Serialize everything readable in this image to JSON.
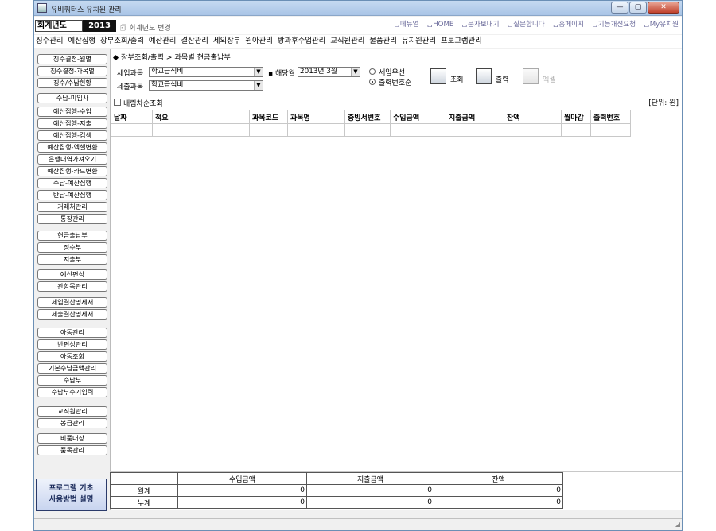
{
  "window": {
    "title": "유비쿼터스 유치원 관리",
    "controls": {
      "min": "—",
      "max": "▢",
      "close": "✕"
    }
  },
  "header": {
    "year_label": "회계년도",
    "year_value": "2013",
    "year_change": "회계년도 변경",
    "links": [
      "메뉴얼",
      "HOME",
      "문자보내기",
      "질문합니다",
      "홈페이지",
      "기능개선요청",
      "My유치원"
    ]
  },
  "menu": {
    "items": [
      "징수관리",
      "예산집행",
      "장부조회/출력",
      "예산관리",
      "결산관리",
      "세외장부",
      "원아관리",
      "방과후수업관리",
      "교직원관리",
      "물품관리",
      "유치원관리",
      "프로그램관리"
    ]
  },
  "sidebar": {
    "items": [
      "징수결정-월별",
      "징수결정-과목별",
      "징수/수납현황",
      "수납-미입사",
      "예산집행-수입",
      "예산집행-지출",
      "예산집행-검색",
      "예산집행-엑셀변환",
      "은행내역가져오기",
      "예산집행-카드변환",
      "수납-예산집행",
      "반납-예산집행",
      "거래처관리",
      "통장관리",
      "현금출납부",
      "징수부",
      "지출부",
      "예산편성",
      "관항목관리",
      "세입결산명세서",
      "세출결산명세서",
      "아동관리",
      "반편성관리",
      "아동조회",
      "기본수납금액관리",
      "수납부",
      "수납부수기입력",
      "교직원관리",
      "봉급관리",
      "비품대장",
      "품목관리"
    ],
    "help_button": [
      "프로그램 기초",
      "사용방법 설명"
    ]
  },
  "main": {
    "breadcrumb": "◆ 장부조회/출력 > 과목별 현금출납부",
    "filters": {
      "income_label": "세입과목",
      "income_value": "학교급식비",
      "expense_label": "세출과목",
      "expense_value": "학교급식비",
      "month_label": "해당월",
      "month_value": "2013년 3월",
      "radio_income_first": "세입우선",
      "radio_output_order": "출력번호순",
      "desc_sort": "내림차순조회"
    },
    "actions": {
      "search": "조회",
      "print": "출력",
      "excel": "엑셀"
    },
    "unit": "[단위: 원]",
    "grid_columns": [
      "날짜",
      "적요",
      "과목코드",
      "과목명",
      "증빙서번호",
      "수입금액",
      "지출금액",
      "잔액",
      "월마감",
      "출력번호"
    ],
    "summary": {
      "headers": [
        "수입금액",
        "지출금액",
        "잔액"
      ],
      "rows": [
        {
          "label": "월계",
          "values": [
            "0",
            "0",
            "0"
          ]
        },
        {
          "label": "누계",
          "values": [
            "0",
            "0",
            "0"
          ]
        }
      ]
    }
  },
  "colors": {
    "title_gradient": "#a9c4e6",
    "close_button": "#c0402b",
    "year_value_bg": "#111111",
    "link_color": "#6a6a9a"
  }
}
